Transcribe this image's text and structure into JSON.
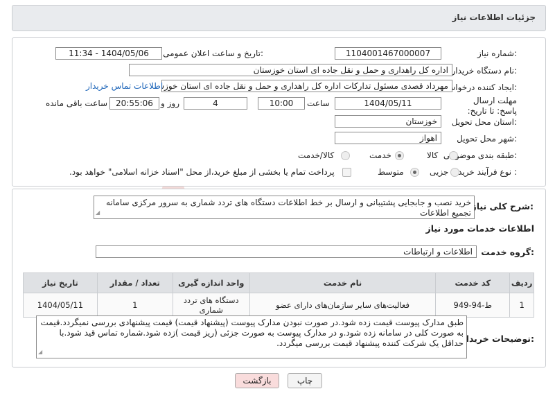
{
  "header": {
    "title": "جزئیات اطلاعات نیاز"
  },
  "form": {
    "need_number_label": "شماره نیاز:",
    "need_number": "1104001467000007",
    "announce_label": "تاریخ و ساعت اعلان عمومی:",
    "announce_value": "1404/05/06 - 11:34",
    "buyer_org_label": "نام دستگاه خریدار:",
    "buyer_org": "اداره کل راهداری و حمل و نقل جاده ای استان خوزستان",
    "requester_label": "ایجاد کننده درخواست:",
    "requester": "مهرداد قصدی مسئول تدارکات اداره کل راهداری و حمل و نقل جاده ای استان خوزستان",
    "contact_link": "اطلاعات تماس خریدار",
    "deadline_label": "مهلت ارسال پاسخ: تا تاریخ:",
    "deadline_date": "1404/05/11",
    "time_label": "ساعت",
    "deadline_time": "10:00",
    "days_value": "4",
    "days_label": "روز و",
    "remaining_time": "20:55:06",
    "remaining_label": "ساعت باقی مانده",
    "province_label": "استان محل تحویل:",
    "province": "خوزستان",
    "city_label": "شهر محل تحویل:",
    "city": "اهواز",
    "category_label": "طبقه بندی موضوعی:",
    "category_options": [
      "کالا",
      "خدمت",
      "کالا/خدمت"
    ],
    "category_selected": "خدمت",
    "process_label": "نوع فرآیند خرید :",
    "process_options": [
      "جزیی",
      "متوسط"
    ],
    "process_selected": "متوسط",
    "payment_note": "پرداخت تمام یا بخشی از مبلغ خرید،از محل \"اسناد خزانه اسلامی\" خواهد بود."
  },
  "details": {
    "general_desc_label": "شرح کلی نیاز:",
    "general_desc": "خرید نصب و جابجایی پشتیبانی و ارسال بر خط اطلاعات دستگاه های تردد شماری به سرور مرکزی سامانه تجمیع اطلاعات",
    "services_heading": "اطلاعات خدمات مورد نیاز",
    "service_group_label": "گروه خدمت:",
    "service_group": "اطلاعات و ارتباطات",
    "table": {
      "headers": [
        "ردیف",
        "کد خدمت",
        "نام خدمت",
        "واحد اندازه گیری",
        "تعداد / مقدار",
        "تاریخ نیاز"
      ],
      "rows": [
        [
          "1",
          "ط-94-949",
          "فعالیت‌های سایر سازمان‌های دارای عضو",
          "دستگاه های تردد شماری",
          "1",
          "1404/05/11"
        ]
      ]
    },
    "buyer_notes_label": "توضیحات خریدار:",
    "buyer_notes": "طبق مدارک پیوست قیمت زده شود.در صورت نبودن مدارک پیوست (پیشنهاد قیمت) قیمت پیشنهادی بررسی نمیگردد.قیمت به صورت کلی در سامانه زده شود.و در مدارک پیوست به صورت جزئی (ریز قیمت )زده شود.شماره تماس قید شود.با حداقل یک شرکت کننده پیشنهاد قیمت بررسی میگردد."
  },
  "buttons": {
    "print": "چاپ",
    "back": "بازگشت"
  },
  "watermark": {
    "text": "AriaTender.neT"
  },
  "colors": {
    "link": "#1a63b8",
    "back_button_bg": "#f9dcdc",
    "header_bg": "#e9ebee"
  }
}
